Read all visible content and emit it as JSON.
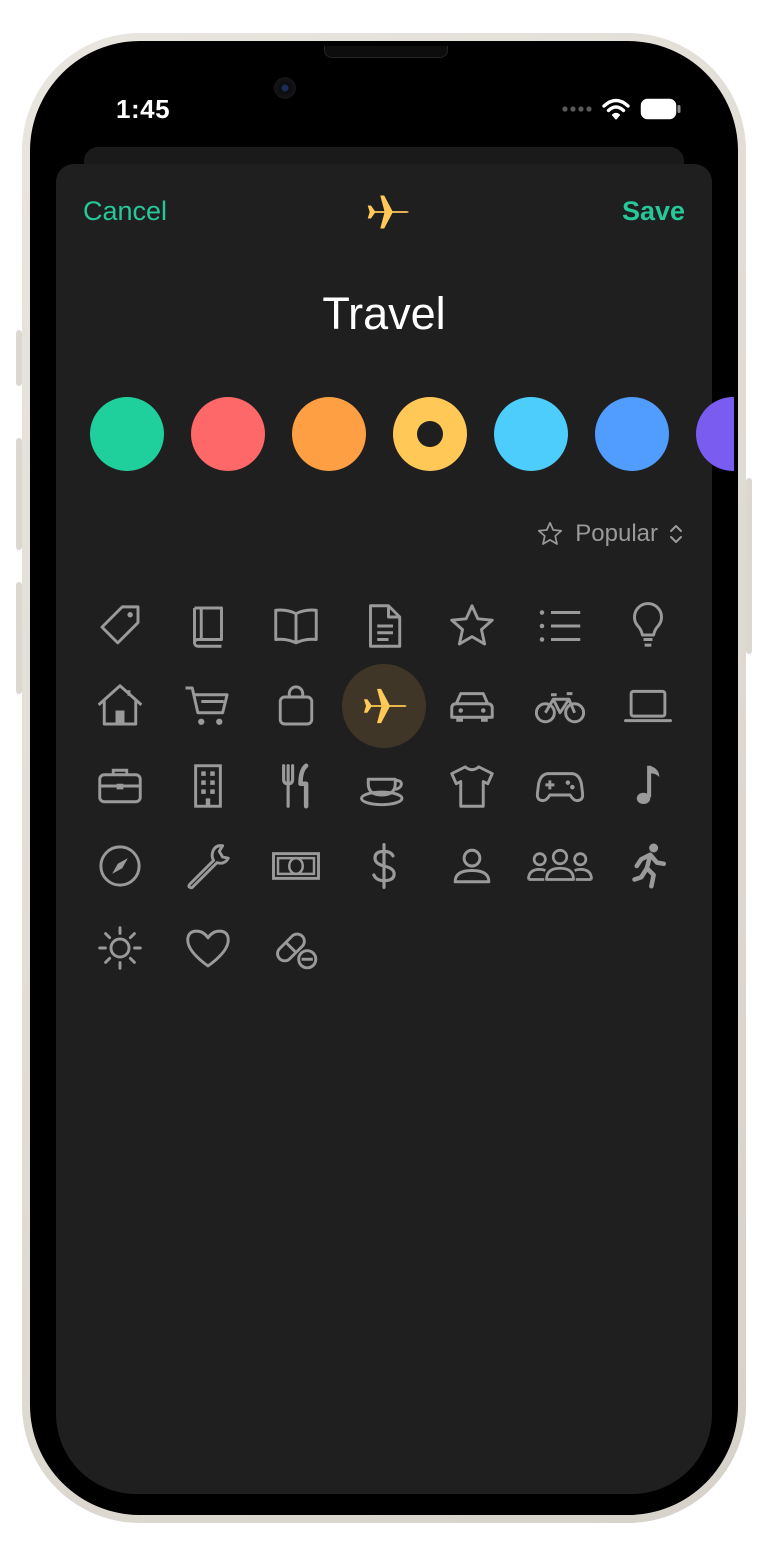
{
  "status_bar": {
    "time": "1:45"
  },
  "header": {
    "cancel_label": "Cancel",
    "save_label": "Save",
    "selected_icon": "airplane-icon"
  },
  "category": {
    "name": "Travel"
  },
  "colors": {
    "accent": "#26c799",
    "selected": "#ffc857",
    "swatches": [
      "#20d09c",
      "#fe6868",
      "#ff9f44",
      "#ffc857",
      "#4ccdfb",
      "#519cff",
      "#7a5cf0"
    ],
    "selected_index": 3
  },
  "filter": {
    "label": "Popular"
  },
  "icons": [
    "tag-icon",
    "book-icon",
    "open-book-icon",
    "document-icon",
    "star-icon",
    "list-icon",
    "lightbulb-icon",
    "house-icon",
    "cart-icon",
    "shopping-bag-icon",
    "airplane-icon",
    "car-icon",
    "bicycle-icon",
    "laptop-icon",
    "briefcase-icon",
    "building-icon",
    "fork-knife-icon",
    "cup-saucer-icon",
    "tshirt-icon",
    "gamecontroller-icon",
    "music-note-icon",
    "compass-icon",
    "wrench-icon",
    "banknote-icon",
    "dollar-icon",
    "person-icon",
    "group-icon",
    "running-figure-icon",
    "sun-icon",
    "heart-icon",
    "pills-icon"
  ]
}
